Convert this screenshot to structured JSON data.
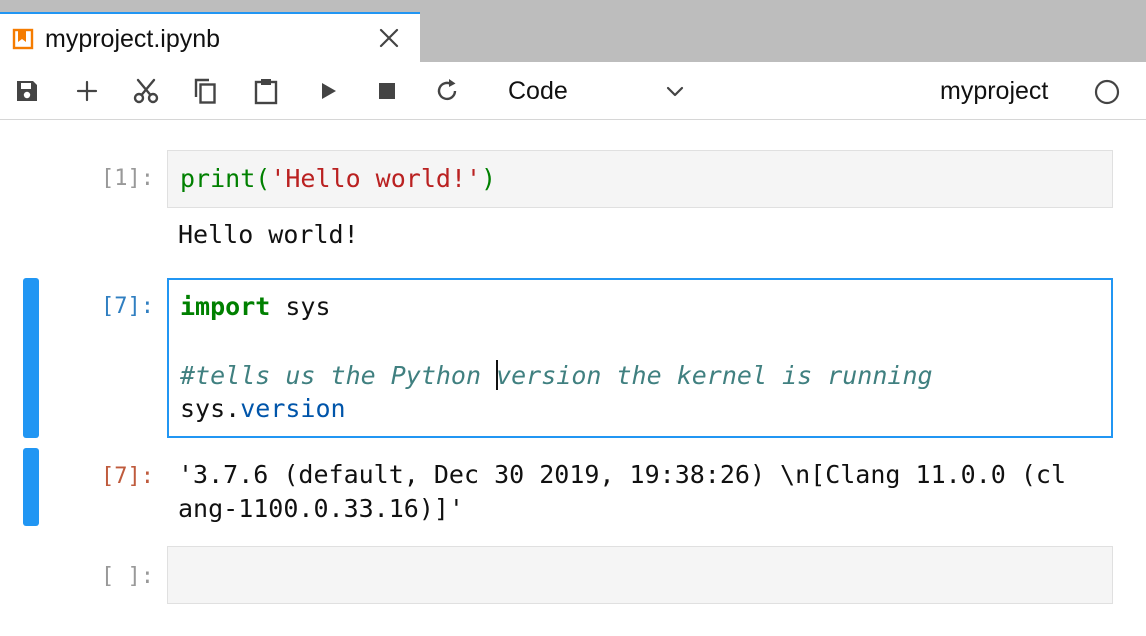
{
  "tab": {
    "title": "myproject.ipynb",
    "icon": "notebook-icon",
    "close_icon": "close-icon",
    "accent_color": "#2196f3",
    "icon_color": "#f57c00"
  },
  "toolbar": {
    "buttons": [
      {
        "name": "save",
        "icon": "save-icon"
      },
      {
        "name": "insert-cell",
        "icon": "plus-icon"
      },
      {
        "name": "cut",
        "icon": "scissors-icon"
      },
      {
        "name": "copy",
        "icon": "copy-icon"
      },
      {
        "name": "paste",
        "icon": "clipboard-icon"
      },
      {
        "name": "run",
        "icon": "play-icon"
      },
      {
        "name": "interrupt",
        "icon": "stop-icon"
      },
      {
        "name": "restart",
        "icon": "refresh-icon"
      }
    ],
    "cell_type": "Code",
    "kernel_name": "myproject",
    "kernel_status": "idle"
  },
  "cells": [
    {
      "prompt": "[1]:",
      "code_tokens": [
        {
          "text": "print",
          "kind": "builtin"
        },
        {
          "text": "(",
          "kind": "builtin"
        },
        {
          "text": "'Hello world!'",
          "kind": "string"
        },
        {
          "text": ")",
          "kind": "builtin"
        }
      ],
      "output": "Hello world!"
    },
    {
      "prompt": "[7]:",
      "line1": {
        "keyword": "import",
        "rest": " sys"
      },
      "comment_before_cursor": "#tells us the Python ",
      "comment_after_cursor": "version the kernel is running",
      "line4": {
        "name": "sys",
        "dot": ".",
        "attr": "version"
      },
      "output_prompt": "[7]:",
      "output_line1": "'3.7.6 (default, Dec 30 2019, 19:38:26) \\n[Clang 11.0.0 (cl",
      "output_line2": "ang-1100.0.33.16)]'"
    },
    {
      "prompt": "[ ]:"
    }
  ],
  "colors": {
    "active_border": "#2196f3",
    "prompt_in_active": "#307fc1",
    "prompt_out": "#bf5b3d",
    "prompt_idle": "#999999",
    "builtin": "#008000",
    "string": "#ba2121",
    "comment": "#408080",
    "attr": "#0055aa"
  }
}
